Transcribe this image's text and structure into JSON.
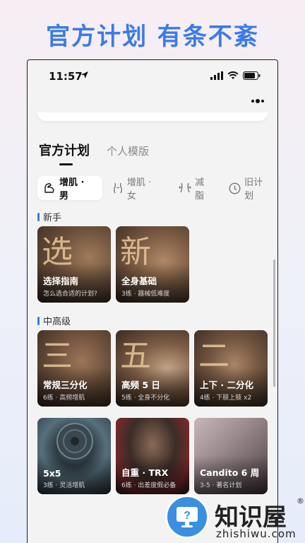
{
  "headline": "官方计划 有条不紊",
  "status": {
    "time": "11:57"
  },
  "tabs": {
    "active": "官方计划",
    "inactive": "个人模版"
  },
  "chips": [
    {
      "label": "增肌 · 男",
      "icon": "muscle-arm-icon"
    },
    {
      "label": "增肌 · 女",
      "icon": "female-body-icon"
    },
    {
      "label": "减脂",
      "icon": "waist-icon"
    },
    {
      "label": "旧计划",
      "icon": "clock-icon"
    }
  ],
  "sections": {
    "beginner": "新手",
    "advanced": "中高级"
  },
  "cards": [
    {
      "char": "选",
      "title": "选择指南",
      "sub": "怎么选合适的计划?"
    },
    {
      "char": "新",
      "title": "全身基础",
      "sub": "3练 · 器械低难度"
    },
    {
      "char": "三",
      "title": "常规三分化",
      "sub": "6练 · 高频增肌"
    },
    {
      "char": "五",
      "title": "高频 5 日",
      "sub": "5练 · 全身不分化"
    },
    {
      "char": "二",
      "title": "上下 · 二分化",
      "sub": "4练 · 下肢上肢 x2"
    },
    {
      "char": "",
      "title": "5x5",
      "sub": "3练 · 灵活增肌"
    },
    {
      "char": "",
      "title": "自重 · TRX",
      "sub": "6练 · 出差度假必备"
    },
    {
      "char": "",
      "title": "Candito 6 周",
      "sub": "3-5 · 著名计划"
    }
  ],
  "watermark": {
    "text": "知识屋",
    "url": "zhishiwu.com",
    "reg": "®"
  },
  "colors": {
    "accent": "#3b7be6",
    "headline": "#3b7be6"
  }
}
